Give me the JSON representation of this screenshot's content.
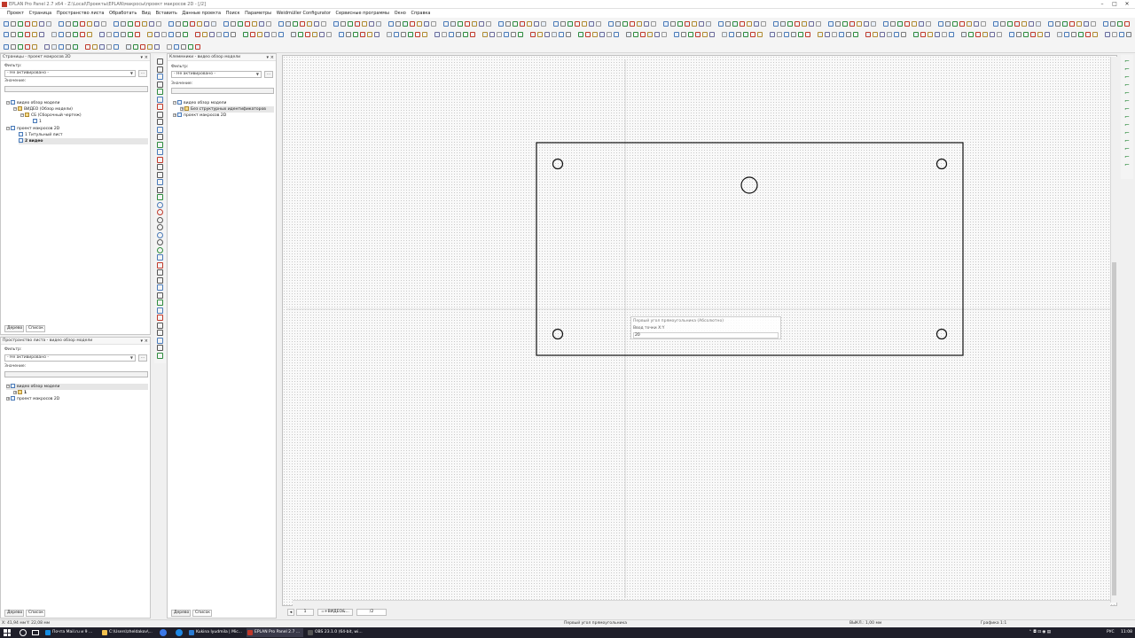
{
  "window": {
    "title": "EPLAN Pro Panel 2.7 x64 - Z:\\Local\\Проекты\\EPLAN\\макросы\\проект макросов 2D - [/2]",
    "minimize": "–",
    "maximize": "□",
    "close": "✕"
  },
  "menu": [
    "Проект",
    "Страница",
    "Пространство листа",
    "Обработать",
    "Вид",
    "Вставить",
    "Данные проекта",
    "Поиск",
    "Параметры",
    "Weidmüller Configurator",
    "Сервисные программы",
    "Окно",
    "Справка"
  ],
  "colors": {
    "accent": "#0078d7",
    "tab_active": "#ffffff",
    "frame_stroke": "#111111",
    "taskbar": "#1f1f2a"
  },
  "pages_panel": {
    "title": "Страницы - проект макросов 2D",
    "filter_label": "Фильтр:",
    "filter_value": "- Не активировано -",
    "dots": "...",
    "value_label": "Значение:",
    "tree": [
      {
        "label": "видео обзор модели",
        "level": 0,
        "icon": "project",
        "exp": "−"
      },
      {
        "label": "ВИДЕО (Обзор модели)",
        "level": 1,
        "icon": "folder",
        "exp": "−"
      },
      {
        "label": "СБ (Сборочный чертеж)",
        "level": 2,
        "icon": "folder",
        "exp": "−"
      },
      {
        "label": "1",
        "level": 3,
        "icon": "page",
        "exp": ""
      },
      {
        "label": "проект макросов 2D",
        "level": 0,
        "icon": "project",
        "exp": "−"
      },
      {
        "label": "1 Титульный лист",
        "level": 1,
        "icon": "page",
        "exp": ""
      },
      {
        "label": "2 видео",
        "level": 1,
        "icon": "page",
        "exp": "",
        "selected": true
      }
    ],
    "tabs": [
      "Дерево",
      "Список"
    ]
  },
  "sheetspace_panel": {
    "title": "Пространство листа - видео обзор модели",
    "filter_label": "Фильтр:",
    "filter_value": "- Не активировано -",
    "dots": "...",
    "value_label": "Значение:",
    "tree": [
      {
        "label": "видео обзор модели",
        "level": 0,
        "icon": "project",
        "exp": "−",
        "selected": true
      },
      {
        "label": "1",
        "level": 1,
        "icon": "folder",
        "exp": "+"
      },
      {
        "label": "проект макросов 2D",
        "level": 0,
        "icon": "project",
        "exp": "+"
      }
    ],
    "tabs": [
      "Дерево",
      "Список"
    ]
  },
  "terminals_panel": {
    "title": "Клеммники - видео обзор модели",
    "filter_label": "Фильтр:",
    "filter_value": "- Не активировано -",
    "dots": "...",
    "value_label": "Значение:",
    "tree": [
      {
        "label": "видео обзор модели",
        "level": 0,
        "icon": "project",
        "exp": "−"
      },
      {
        "label": "Без структурных идентификаторов",
        "level": 1,
        "icon": "folder",
        "exp": "+",
        "selected": true
      },
      {
        "label": "проект макросов 2D",
        "level": 0,
        "icon": "project",
        "exp": "+"
      }
    ],
    "tabs": [
      "Дерево",
      "Список"
    ]
  },
  "drawing": {
    "prompt_title": "Первый угол прямоугольника (Абсолютно)",
    "prompt_label": "Ввод точки X:Y",
    "prompt_value": "20"
  },
  "page_tabs": [
    "1",
    "=+ВИДЕО&...",
    "/2"
  ],
  "status": {
    "x": "X: 41,94 мм",
    "y": "Y: 22,08 мм",
    "message": "Первый угол прямоугольника",
    "grid": "ВЫКЛ.: 1,00 мм",
    "view": "Графика 1:1"
  },
  "taskbar": {
    "items": [
      {
        "label": "Почта Mail.ru и 9 ...",
        "color": "#168de2"
      },
      {
        "label": "C:\\Users\\zheldakov\\...",
        "color": "#f2c14e"
      },
      {
        "label": "Kukina lyudmila | Mic...",
        "color": "#2b7cd3"
      },
      {
        "label": "EPLAN Pro Panel 2.7 ...",
        "color": "#c0392b",
        "active": true
      },
      {
        "label": "OBS 23.1.0 (64-bit, wi...",
        "color": "#555555"
      }
    ],
    "lang": "РУС",
    "time": "11:08"
  }
}
